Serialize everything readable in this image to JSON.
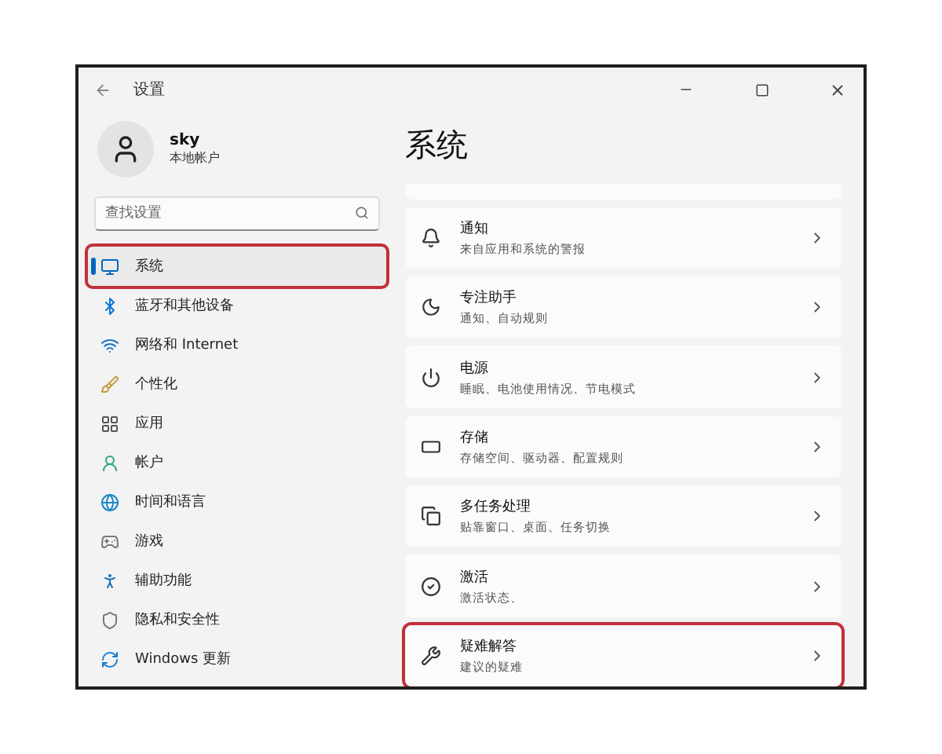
{
  "window": {
    "title": "设置"
  },
  "user": {
    "name": "sky",
    "account": "本地帐户"
  },
  "search": {
    "placeholder": "查找设置"
  },
  "sidebar": {
    "items": [
      {
        "kind": "system",
        "label": "系统",
        "selected": true,
        "highlighted": true
      },
      {
        "kind": "bluetooth",
        "label": "蓝牙和其他设备",
        "selected": false,
        "highlighted": false
      },
      {
        "kind": "network",
        "label": "网络和 Internet",
        "selected": false,
        "highlighted": false
      },
      {
        "kind": "personalize",
        "label": "个性化",
        "selected": false,
        "highlighted": false
      },
      {
        "kind": "apps",
        "label": "应用",
        "selected": false,
        "highlighted": false
      },
      {
        "kind": "account",
        "label": "帐户",
        "selected": false,
        "highlighted": false
      },
      {
        "kind": "time",
        "label": "时间和语言",
        "selected": false,
        "highlighted": false
      },
      {
        "kind": "gaming",
        "label": "游戏",
        "selected": false,
        "highlighted": false
      },
      {
        "kind": "accessibility",
        "label": "辅助功能",
        "selected": false,
        "highlighted": false
      },
      {
        "kind": "privacy",
        "label": "隐私和安全性",
        "selected": false,
        "highlighted": false
      },
      {
        "kind": "update",
        "label": "Windows 更新",
        "selected": false,
        "highlighted": false
      }
    ]
  },
  "page": {
    "title": "系统",
    "cards": [
      {
        "kind": "notifications",
        "title": "通知",
        "subtitle": "来自应用和系统的警报",
        "highlighted": false
      },
      {
        "kind": "focus",
        "title": "专注助手",
        "subtitle": "通知、自动规则",
        "highlighted": false
      },
      {
        "kind": "power",
        "title": "电源",
        "subtitle": "睡眠、电池使用情况、节电模式",
        "highlighted": false
      },
      {
        "kind": "storage",
        "title": "存储",
        "subtitle": "存储空间、驱动器、配置规则",
        "highlighted": false
      },
      {
        "kind": "multitask",
        "title": "多任务处理",
        "subtitle": "贴靠窗口、桌面、任务切换",
        "highlighted": false
      },
      {
        "kind": "activation",
        "title": "激活",
        "subtitle": "激活状态、",
        "highlighted": false
      },
      {
        "kind": "troubleshoot",
        "title": "疑难解答",
        "subtitle": "建议的疑难",
        "highlighted": true
      }
    ]
  }
}
